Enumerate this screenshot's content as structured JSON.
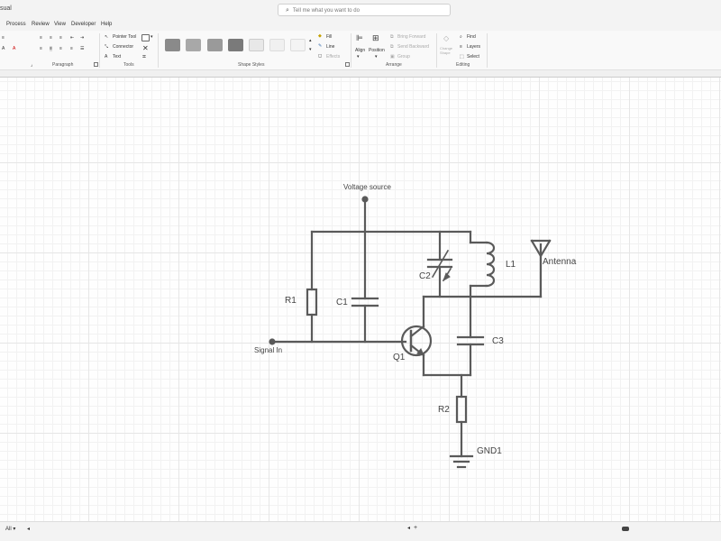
{
  "app": {
    "title": "sual"
  },
  "search": {
    "placeholder": "Tell me what you want to do"
  },
  "menu": [
    "Process",
    "Review",
    "View",
    "Developer",
    "Help"
  ],
  "ribbon": {
    "groups": {
      "paragraph": "Paragraph",
      "tools": "Tools",
      "shape_styles": "Shape Styles",
      "arrange": "Arrange",
      "editing": "Editing"
    },
    "tools": {
      "pointer": "Pointer Tool",
      "connector": "Connector",
      "text": "Text"
    },
    "shape": {
      "fill": "Fill",
      "line": "Line",
      "effects": "Effects"
    },
    "arrange": {
      "align": "Align",
      "position": "Position",
      "bring_forward": "Bring Forward",
      "send_backward": "Send Backward",
      "group": "Group"
    },
    "editing": {
      "change_shape": "Change Shape",
      "find": "Find",
      "layers": "Layers",
      "select": "Select"
    },
    "style_swatches": [
      "#8a8a8a",
      "#a8a8a8",
      "#9a9a9a",
      "#7a7a7a",
      "#e8e8e8",
      "#f0f0f0",
      "#f4f4f4"
    ]
  },
  "diagram": {
    "labels": {
      "voltage_source": "Voltage source",
      "r1": "R1",
      "c1": "C1",
      "c2": "C2",
      "l1": "L1",
      "antenna": "Antenna",
      "c3": "C3",
      "signal_in": "Signal In",
      "q1": "Q1",
      "r2": "R2",
      "gnd1": "GND1"
    }
  },
  "status": {
    "page": "All"
  }
}
